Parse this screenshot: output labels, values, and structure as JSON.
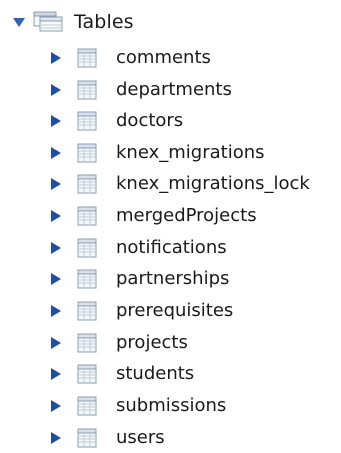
{
  "tree": {
    "root": {
      "label": "Tables",
      "expanded": true,
      "icon": "tables-folder-icon"
    },
    "items": [
      {
        "label": "comments",
        "icon": "table-icon"
      },
      {
        "label": "departments",
        "icon": "table-icon"
      },
      {
        "label": "doctors",
        "icon": "table-icon"
      },
      {
        "label": "knex_migrations",
        "icon": "table-icon"
      },
      {
        "label": "knex_migrations_lock",
        "icon": "table-icon"
      },
      {
        "label": "mergedProjects",
        "icon": "table-icon"
      },
      {
        "label": "notifications",
        "icon": "table-icon"
      },
      {
        "label": "partnerships",
        "icon": "table-icon"
      },
      {
        "label": "prerequisites",
        "icon": "table-icon"
      },
      {
        "label": "projects",
        "icon": "table-icon"
      },
      {
        "label": "students",
        "icon": "table-icon"
      },
      {
        "label": "submissions",
        "icon": "table-icon"
      },
      {
        "label": "users",
        "icon": "table-icon"
      }
    ]
  },
  "colors": {
    "arrow_expanded": "#2f62b8",
    "arrow_collapsed": "#1e4fa6",
    "icon_stroke": "#8e9cae",
    "icon_fill": "#f4f7fb",
    "text": "#1a1a1a"
  }
}
